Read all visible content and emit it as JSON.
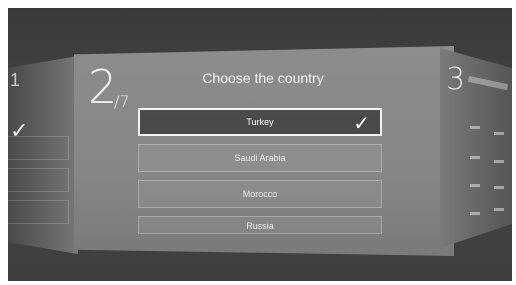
{
  "step": {
    "current": "2",
    "total": "/7"
  },
  "title": "Choose the country",
  "options": [
    {
      "label": "Turkey",
      "selected": true
    },
    {
      "label": "Saudi Arabia",
      "selected": false
    },
    {
      "label": "Morocco",
      "selected": false
    },
    {
      "label": "Russia",
      "selected": false
    }
  ],
  "selected_icon": "check-icon",
  "next_panel": {
    "step": "3"
  }
}
